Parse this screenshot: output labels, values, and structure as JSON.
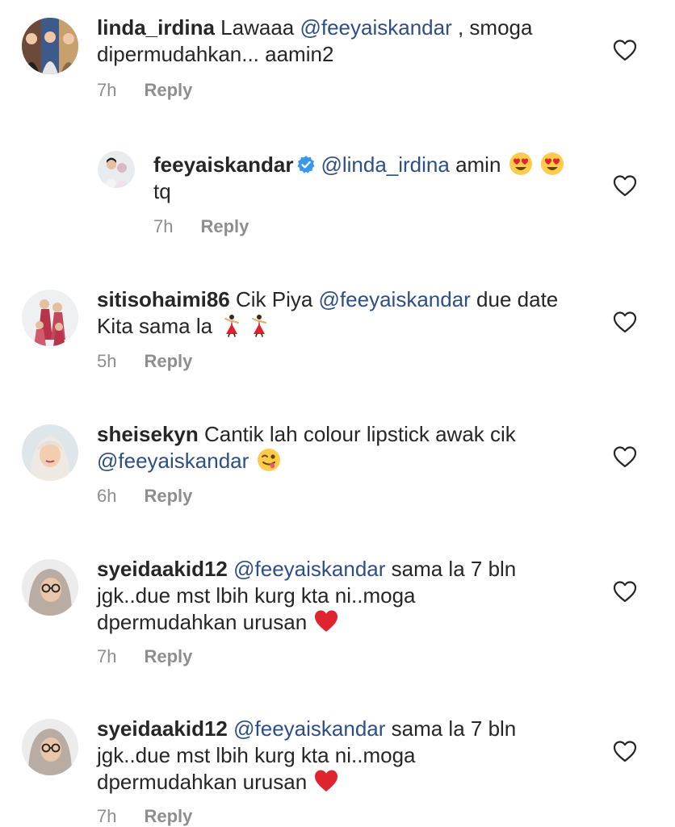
{
  "comments": [
    {
      "username": "linda_irdina",
      "text_before": "Lawaaa ",
      "mention": "@feeyaiskandar",
      "text_after": " , smoga dipermudahkan... aamin2",
      "time": "7h",
      "reply_label": "Reply"
    },
    {
      "username": "feeyaiskandar",
      "verified": true,
      "mention": "@linda_irdina",
      "text_after": " amin ",
      "text_end": " tq",
      "emoji": "heart-eyes",
      "time": "7h",
      "reply_label": "Reply"
    },
    {
      "username": "sitisohaimi86",
      "text_before": "Cik Piya ",
      "mention": "@feeyaiskandar",
      "text_after": " due date Kita sama la ",
      "emoji": "dancer",
      "time": "5h",
      "reply_label": "Reply"
    },
    {
      "username": "sheisekyn",
      "text_before": "Cantik lah colour lipstick awak cik ",
      "mention": "@feeyaiskandar",
      "emoji": "winking-tongue",
      "time": "6h",
      "reply_label": "Reply"
    },
    {
      "username": "syeidaakid12",
      "mention": "@feeyaiskandar",
      "text_after": " sama la 7 bln jgk..due mst lbih kurg kta ni..moga dpermudahkan urusan ",
      "emoji": "red-heart",
      "time": "7h",
      "reply_label": "Reply"
    },
    {
      "username": "syeidaakid12",
      "mention": "@feeyaiskandar",
      "text_after": " sama la 7 bln jgk..due mst lbih kurg kta ni..moga dpermudahkan urusan ",
      "emoji": "red-heart",
      "time": "7h",
      "reply_label": "Reply"
    }
  ],
  "icons": {
    "like": "heart-outline-icon",
    "verified": "verified-badge-icon"
  },
  "colors": {
    "mention": "#2d4f85",
    "meta": "#8e8e8e",
    "verified": "#3897f0",
    "heart_emoji": "#e0242f"
  }
}
